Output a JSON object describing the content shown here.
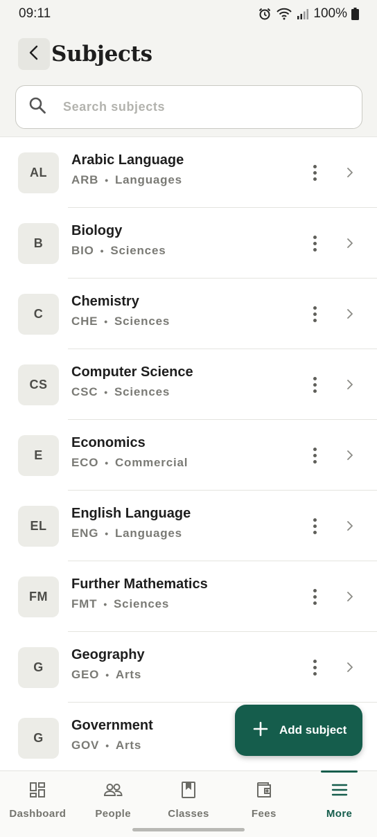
{
  "status_bar": {
    "time": "09:11",
    "battery": "100%",
    "icons": [
      "alarm-icon",
      "wifi-icon",
      "signal-icon",
      "battery-icon"
    ]
  },
  "header": {
    "title": "Subjects",
    "back_icon": "chevron-left-icon"
  },
  "search": {
    "placeholder": "Search subjects",
    "value": "",
    "icon": "search-icon"
  },
  "subjects": [
    {
      "initials": "AL",
      "name": "Arabic Language",
      "code": "ARB",
      "category": "Languages"
    },
    {
      "initials": "B",
      "name": "Biology",
      "code": "BIO",
      "category": "Sciences"
    },
    {
      "initials": "C",
      "name": "Chemistry",
      "code": "CHE",
      "category": "Sciences"
    },
    {
      "initials": "CS",
      "name": "Computer Science",
      "code": "CSC",
      "category": "Sciences"
    },
    {
      "initials": "E",
      "name": "Economics",
      "code": "ECO",
      "category": "Commercial"
    },
    {
      "initials": "EL",
      "name": "English Language",
      "code": "ENG",
      "category": "Languages"
    },
    {
      "initials": "FM",
      "name": "Further Mathematics",
      "code": "FMT",
      "category": "Sciences"
    },
    {
      "initials": "G",
      "name": "Geography",
      "code": "GEO",
      "category": "Arts"
    },
    {
      "initials": "G",
      "name": "Government",
      "code": "GOV",
      "category": "Arts"
    }
  ],
  "separator": "•",
  "fab": {
    "label": "Add subject",
    "icon": "plus-icon"
  },
  "bottom_nav": [
    {
      "label": "Dashboard",
      "icon": "dashboard-icon",
      "active": false
    },
    {
      "label": "People",
      "icon": "people-icon",
      "active": false
    },
    {
      "label": "Classes",
      "icon": "book-icon",
      "active": false
    },
    {
      "label": "Fees",
      "icon": "wallet-icon",
      "active": false
    },
    {
      "label": "More",
      "icon": "menu-icon",
      "active": true
    }
  ],
  "colors": {
    "accent": "#155d4c",
    "header_bg": "#f4f4f1",
    "avatar_bg": "#ecece7",
    "muted_text": "#7a7a75"
  }
}
